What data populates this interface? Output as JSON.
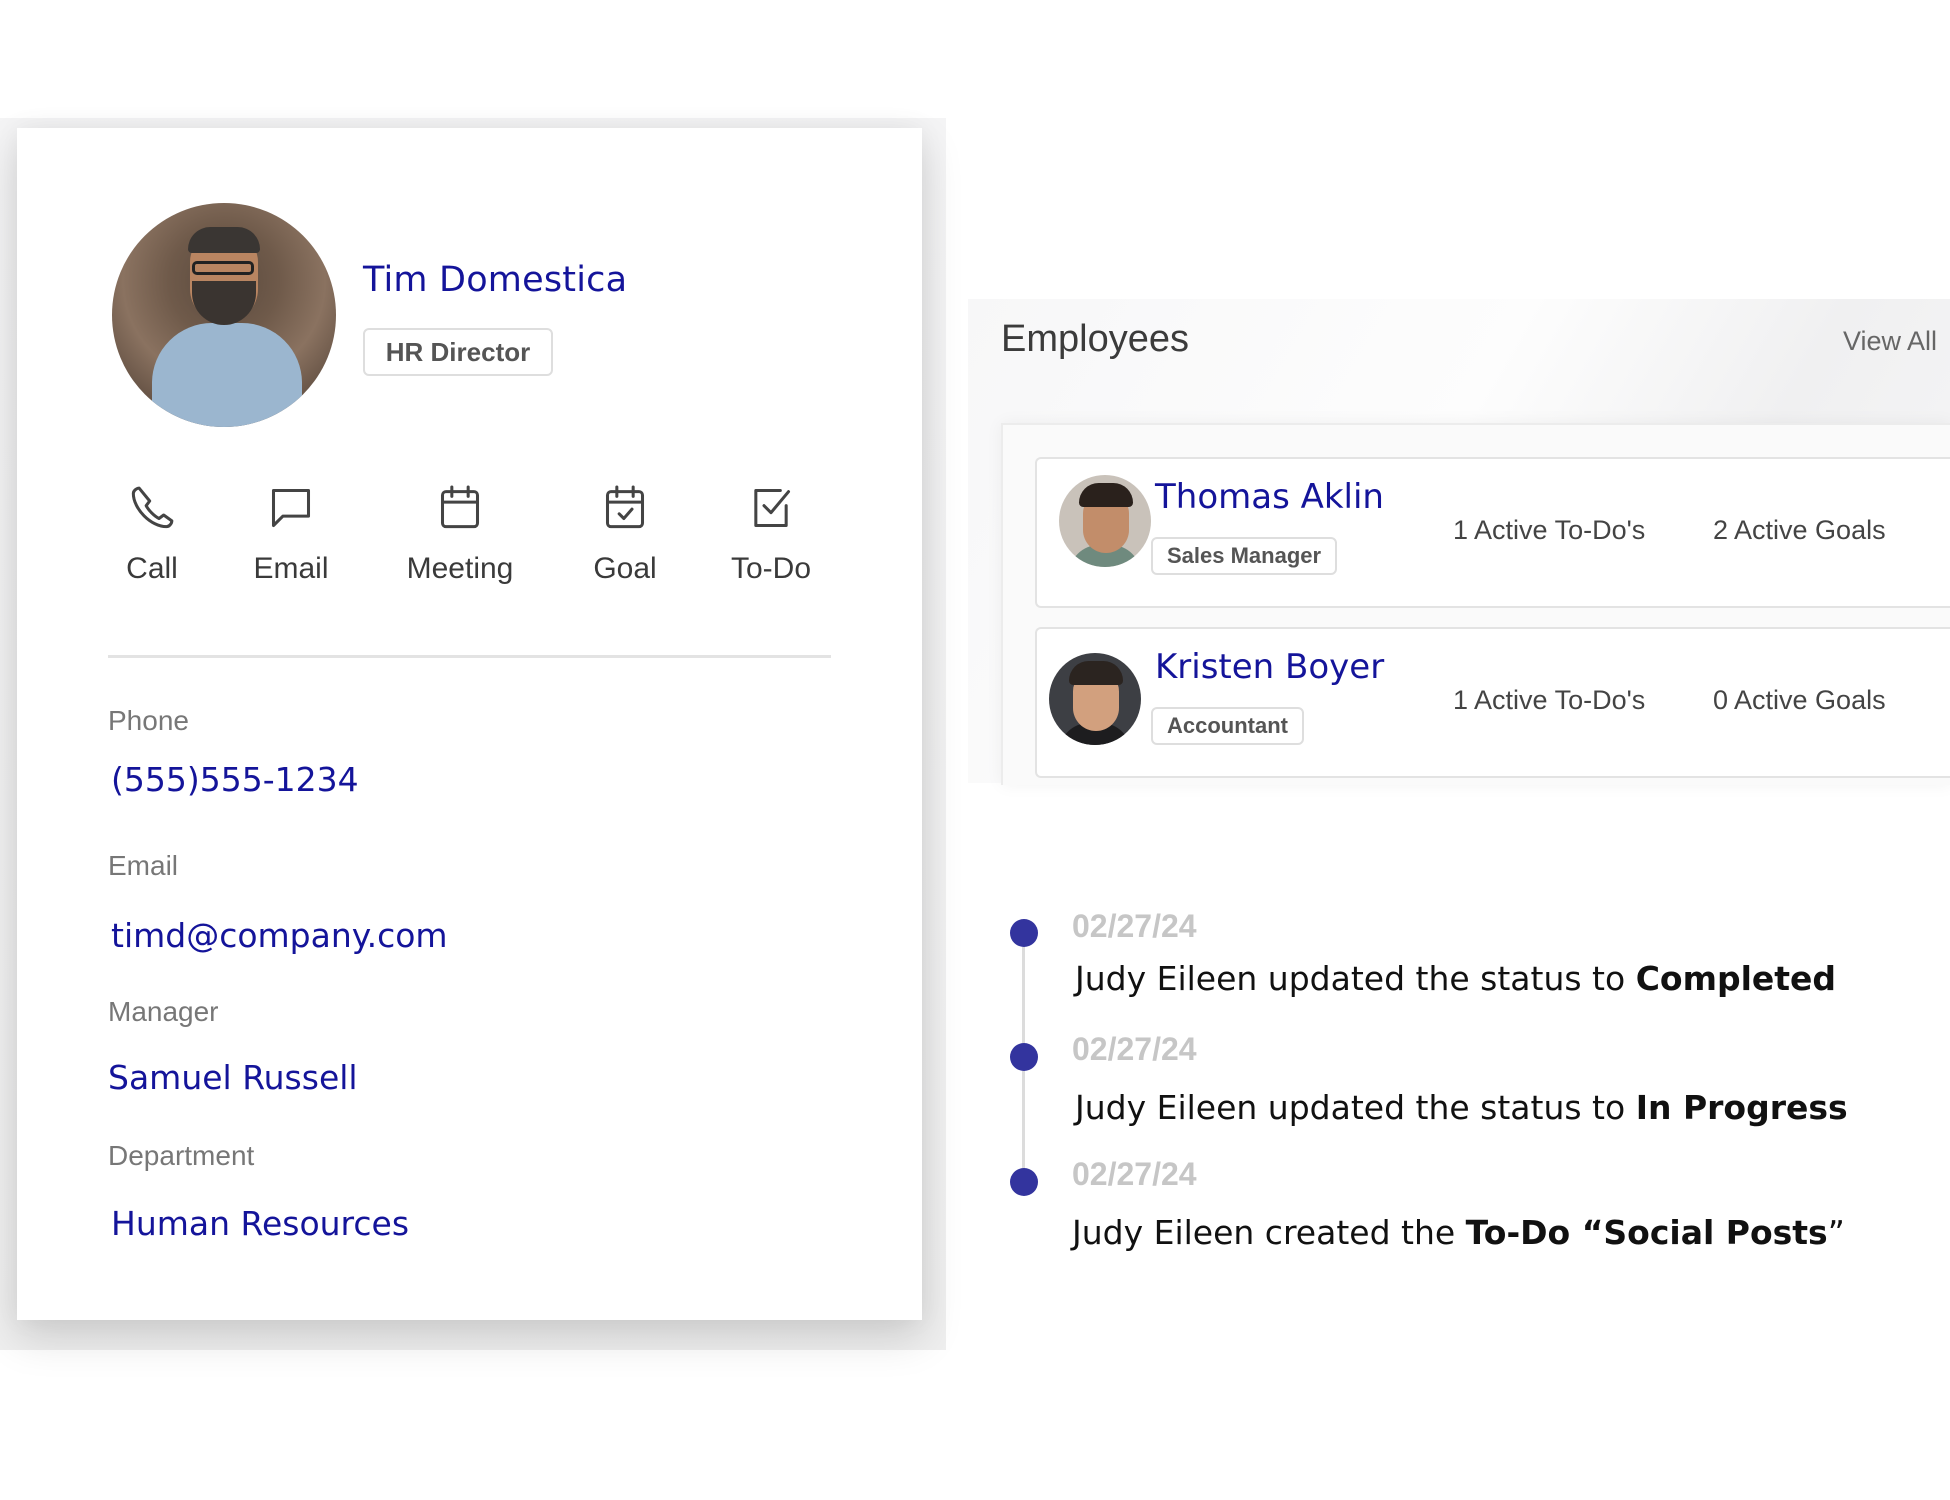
{
  "profile": {
    "name": "Tim Domestica",
    "title_badge": "HR Director",
    "avatar": "profile-photo",
    "actions": [
      {
        "label": "Call",
        "icon": "phone-icon"
      },
      {
        "label": "Email",
        "icon": "chat-bubble-icon"
      },
      {
        "label": "Meeting",
        "icon": "calendar-icon"
      },
      {
        "label": "Goal",
        "icon": "calendar-check-icon"
      },
      {
        "label": "To-Do",
        "icon": "checkbox-icon"
      }
    ],
    "fields": [
      {
        "label": "Phone",
        "value": "(555)555-1234"
      },
      {
        "label": "Email",
        "value": "timd@company.com"
      },
      {
        "label": "Manager",
        "value": "Samuel Russell"
      },
      {
        "label": "Department",
        "value": "Human Resources"
      }
    ]
  },
  "employees": {
    "title": "Employees",
    "view_all": "View All",
    "rows": [
      {
        "name": "Thomas Aklin",
        "role": "Sales Manager",
        "todos": "1 Active To-Do's",
        "goals": "2 Active Goals"
      },
      {
        "name": "Kristen Boyer",
        "role": "Accountant",
        "todos": "1 Active To-Do's",
        "goals": "0 Active Goals"
      }
    ]
  },
  "timeline": {
    "accent_color": "#33349e",
    "items": [
      {
        "date": "02/27/24",
        "text": "Judy Eileen updated the status to ",
        "bold": "Completed",
        "tail": ""
      },
      {
        "date": "02/27/24",
        "text": "Judy Eileen updated the status to ",
        "bold": "In Progress",
        "tail": ""
      },
      {
        "date": "02/27/24",
        "text": "Judy Eileen created the ",
        "bold": "To-Do “Social Posts",
        "tail": "”"
      }
    ]
  },
  "colors": {
    "link_blue": "#14149a",
    "label_gray": "#777777",
    "date_gray": "#c6c6c6"
  }
}
